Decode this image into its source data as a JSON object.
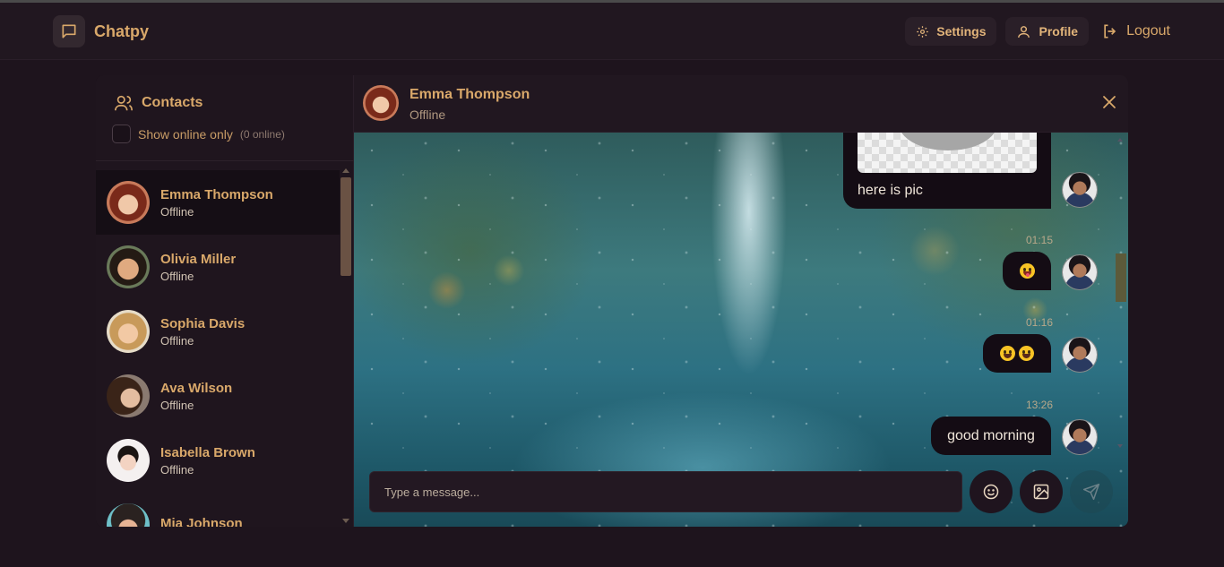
{
  "app": {
    "name": "Chatpy"
  },
  "nav": {
    "settings": "Settings",
    "profile": "Profile",
    "logout": "Logout"
  },
  "sidebar": {
    "title": "Contacts",
    "online_toggle_label": "Show online only",
    "online_count": "(0 online)",
    "contacts": [
      {
        "name": "Emma Thompson",
        "status": "Offline"
      },
      {
        "name": "Olivia Miller",
        "status": "Offline"
      },
      {
        "name": "Sophia Davis",
        "status": "Offline"
      },
      {
        "name": "Ava Wilson",
        "status": "Offline"
      },
      {
        "name": "Isabella Brown",
        "status": "Offline"
      },
      {
        "name": "Mia Johnson",
        "status": ""
      }
    ]
  },
  "chat": {
    "name": "Emma Thompson",
    "status": "Offline",
    "messages": [
      {
        "text": "here is pic",
        "time": ""
      },
      {
        "text": "😛",
        "time": "01:15"
      },
      {
        "text": "🤣🤣",
        "time": "01:16"
      },
      {
        "text": "good morning",
        "time": "13:26"
      }
    ],
    "input_placeholder": "Type a message..."
  },
  "colors": {
    "accent": "#d9a86a",
    "bg": "#1e141d",
    "bubble": "#140c14"
  }
}
